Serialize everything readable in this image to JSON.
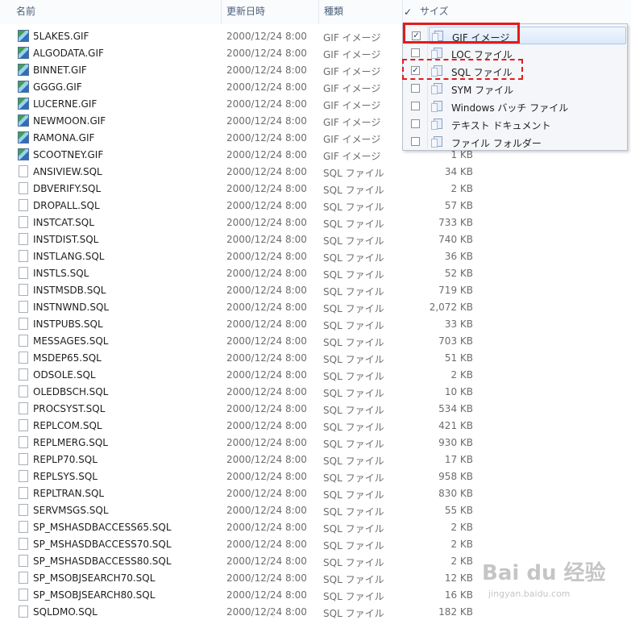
{
  "header": {
    "name": "名前",
    "date": "更新日時",
    "type": "種類",
    "size": "サイズ"
  },
  "rows": [
    {
      "name": "5LAKES.GIF",
      "date": "2000/12/24 8:00",
      "type": "GIF イメージ",
      "size": "",
      "kind": "gif"
    },
    {
      "name": "ALGODATA.GIF",
      "date": "2000/12/24 8:00",
      "type": "GIF イメージ",
      "size": "",
      "kind": "gif"
    },
    {
      "name": "BINNET.GIF",
      "date": "2000/12/24 8:00",
      "type": "GIF イメージ",
      "size": "",
      "kind": "gif"
    },
    {
      "name": "GGGG.GIF",
      "date": "2000/12/24 8:00",
      "type": "GIF イメージ",
      "size": "",
      "kind": "gif"
    },
    {
      "name": "LUCERNE.GIF",
      "date": "2000/12/24 8:00",
      "type": "GIF イメージ",
      "size": "",
      "kind": "gif"
    },
    {
      "name": "NEWMOON.GIF",
      "date": "2000/12/24 8:00",
      "type": "GIF イメージ",
      "size": "",
      "kind": "gif"
    },
    {
      "name": "RAMONA.GIF",
      "date": "2000/12/24 8:00",
      "type": "GIF イメージ",
      "size": "",
      "kind": "gif"
    },
    {
      "name": "SCOOTNEY.GIF",
      "date": "2000/12/24 8:00",
      "type": "GIF イメージ",
      "size": "1 KB",
      "kind": "gif"
    },
    {
      "name": "ANSIVIEW.SQL",
      "date": "2000/12/24 8:00",
      "type": "SQL ファイル",
      "size": "34 KB",
      "kind": "sql"
    },
    {
      "name": "DBVERIFY.SQL",
      "date": "2000/12/24 8:00",
      "type": "SQL ファイル",
      "size": "2 KB",
      "kind": "sql"
    },
    {
      "name": "DROPALL.SQL",
      "date": "2000/12/24 8:00",
      "type": "SQL ファイル",
      "size": "57 KB",
      "kind": "sql"
    },
    {
      "name": "INSTCAT.SQL",
      "date": "2000/12/24 8:00",
      "type": "SQL ファイル",
      "size": "733 KB",
      "kind": "sql"
    },
    {
      "name": "INSTDIST.SQL",
      "date": "2000/12/24 8:00",
      "type": "SQL ファイル",
      "size": "740 KB",
      "kind": "sql"
    },
    {
      "name": "INSTLANG.SQL",
      "date": "2000/12/24 8:00",
      "type": "SQL ファイル",
      "size": "36 KB",
      "kind": "sql"
    },
    {
      "name": "INSTLS.SQL",
      "date": "2000/12/24 8:00",
      "type": "SQL ファイル",
      "size": "52 KB",
      "kind": "sql"
    },
    {
      "name": "INSTMSDB.SQL",
      "date": "2000/12/24 8:00",
      "type": "SQL ファイル",
      "size": "719 KB",
      "kind": "sql"
    },
    {
      "name": "INSTNWND.SQL",
      "date": "2000/12/24 8:00",
      "type": "SQL ファイル",
      "size": "2,072 KB",
      "kind": "sql"
    },
    {
      "name": "INSTPUBS.SQL",
      "date": "2000/12/24 8:00",
      "type": "SQL ファイル",
      "size": "33 KB",
      "kind": "sql"
    },
    {
      "name": "MESSAGES.SQL",
      "date": "2000/12/24 8:00",
      "type": "SQL ファイル",
      "size": "703 KB",
      "kind": "sql"
    },
    {
      "name": "MSDEP65.SQL",
      "date": "2000/12/24 8:00",
      "type": "SQL ファイル",
      "size": "51 KB",
      "kind": "sql"
    },
    {
      "name": "ODSOLE.SQL",
      "date": "2000/12/24 8:00",
      "type": "SQL ファイル",
      "size": "2 KB",
      "kind": "sql"
    },
    {
      "name": "OLEDBSCH.SQL",
      "date": "2000/12/24 8:00",
      "type": "SQL ファイル",
      "size": "10 KB",
      "kind": "sql"
    },
    {
      "name": "PROCSYST.SQL",
      "date": "2000/12/24 8:00",
      "type": "SQL ファイル",
      "size": "534 KB",
      "kind": "sql"
    },
    {
      "name": "REPLCOM.SQL",
      "date": "2000/12/24 8:00",
      "type": "SQL ファイル",
      "size": "421 KB",
      "kind": "sql"
    },
    {
      "name": "REPLMERG.SQL",
      "date": "2000/12/24 8:00",
      "type": "SQL ファイル",
      "size": "930 KB",
      "kind": "sql"
    },
    {
      "name": "REPLP70.SQL",
      "date": "2000/12/24 8:00",
      "type": "SQL ファイル",
      "size": "17 KB",
      "kind": "sql"
    },
    {
      "name": "REPLSYS.SQL",
      "date": "2000/12/24 8:00",
      "type": "SQL ファイル",
      "size": "958 KB",
      "kind": "sql"
    },
    {
      "name": "REPLTRAN.SQL",
      "date": "2000/12/24 8:00",
      "type": "SQL ファイル",
      "size": "830 KB",
      "kind": "sql"
    },
    {
      "name": "SERVMSGS.SQL",
      "date": "2000/12/24 8:00",
      "type": "SQL ファイル",
      "size": "55 KB",
      "kind": "sql"
    },
    {
      "name": "SP_MSHASDBACCESS65.SQL",
      "date": "2000/12/24 8:00",
      "type": "SQL ファイル",
      "size": "2 KB",
      "kind": "sql"
    },
    {
      "name": "SP_MSHASDBACCESS70.SQL",
      "date": "2000/12/24 8:00",
      "type": "SQL ファイル",
      "size": "2 KB",
      "kind": "sql"
    },
    {
      "name": "SP_MSHASDBACCESS80.SQL",
      "date": "2000/12/24 8:00",
      "type": "SQL ファイル",
      "size": "2 KB",
      "kind": "sql"
    },
    {
      "name": "SP_MSOBJSEARCH70.SQL",
      "date": "2000/12/24 8:00",
      "type": "SQL ファイル",
      "size": "12 KB",
      "kind": "sql"
    },
    {
      "name": "SP_MSOBJSEARCH80.SQL",
      "date": "2000/12/24 8:00",
      "type": "SQL ファイル",
      "size": "16 KB",
      "kind": "sql"
    },
    {
      "name": "SQLDMO.SQL",
      "date": "2000/12/24 8:00",
      "type": "SQL ファイル",
      "size": "182 KB",
      "kind": "sql"
    }
  ],
  "filter_menu": [
    {
      "label": "GIF イメージ",
      "checked": true
    },
    {
      "label": "LOC ファイル",
      "checked": false
    },
    {
      "label": "SQL ファイル",
      "checked": true
    },
    {
      "label": "SYM ファイル",
      "checked": false
    },
    {
      "label": "Windows バッチ ファイル",
      "checked": false
    },
    {
      "label": "テキスト ドキュメント",
      "checked": false
    },
    {
      "label": "ファイル フォルダー",
      "checked": false
    }
  ],
  "watermark": {
    "text": "Bai du 经验",
    "sub": "jingyan.baidu.com"
  }
}
